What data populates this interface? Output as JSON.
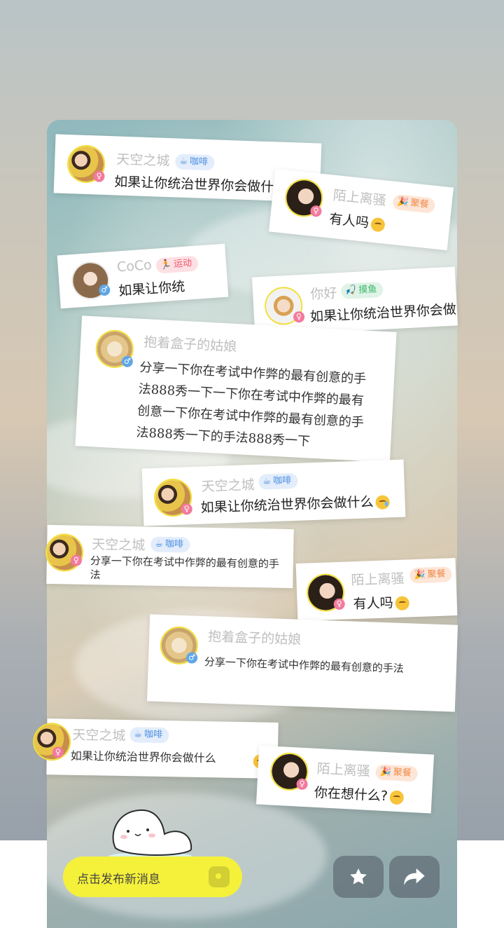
{
  "cards": [
    {
      "name": "天空之城",
      "tag": {
        "type": "coffee",
        "icon": "☕",
        "label": "咖啡"
      },
      "gender": "♀",
      "message": "如果让你统治世界你会做什"
    },
    {
      "name": "陌上离骚",
      "tag": {
        "type": "party",
        "icon": "🎉",
        "label": "聚餐"
      },
      "gender": "♀",
      "message": "有人吗"
    },
    {
      "name": "CoCo",
      "tag": {
        "type": "sport",
        "icon": "🏃",
        "label": "运动"
      },
      "gender": "♂",
      "message": "如果让你统"
    },
    {
      "name": "你好",
      "tag": {
        "type": "fish",
        "icon": "🎣",
        "label": "摸鱼"
      },
      "gender": "♀",
      "message": "如果让你统治世界你会做"
    },
    {
      "name": "抱着盒子的姑娘",
      "gender": "♂",
      "message": "分享一下你在考试中作弊的最有创意的手法888秀一下一下你在考试中作弊的最有创意一下你在考试中作弊的最有创意的手法888秀一下的手法888秀一下"
    },
    {
      "name": "天空之城",
      "tag": {
        "type": "coffee",
        "icon": "☕",
        "label": "咖啡"
      },
      "gender": "♀",
      "message": "如果让你统治世界你会做什么"
    },
    {
      "name": "天空之城",
      "tag": {
        "type": "coffee",
        "icon": "☕",
        "label": "咖啡"
      },
      "gender": "♀",
      "message": "分享一下你在考试中作弊的最有创意的手法"
    },
    {
      "name": "陌上离骚",
      "tag": {
        "type": "party",
        "icon": "🎉",
        "label": "聚餐"
      },
      "gender": "♀",
      "message": "有人吗"
    },
    {
      "name": "抱着盒子的姑娘",
      "gender": "♂",
      "message": "分享一下你在考试中作弊的最有创意的手法"
    },
    {
      "name": "天空之城",
      "tag": {
        "type": "coffee",
        "icon": "☕",
        "label": "咖啡"
      },
      "gender": "♀",
      "message": "如果让你统治世界你会做什么"
    },
    {
      "name": "陌上离骚",
      "tag": {
        "type": "party",
        "icon": "🎉",
        "label": "聚餐"
      },
      "gender": "♀",
      "message": "你在想什么?"
    }
  ],
  "publish": {
    "placeholder": "点击发布新消息"
  },
  "actions": {
    "favorite_icon": "star-icon",
    "share_icon": "share-icon"
  },
  "colors": {
    "accent": "#f5f13a",
    "avatar_border": "#f2df3a",
    "female": "#f37a9c",
    "male": "#5fa7e6"
  }
}
